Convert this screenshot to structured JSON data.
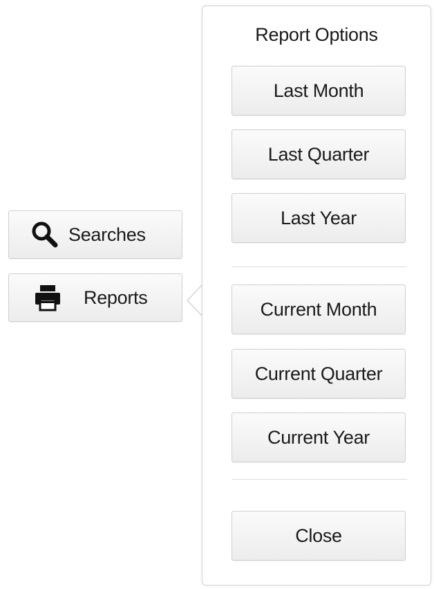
{
  "sidebar": {
    "buttons": [
      {
        "label": "Searches",
        "icon": "search-icon"
      },
      {
        "label": "Reports",
        "icon": "printer-icon"
      }
    ]
  },
  "report_options": {
    "title": "Report Options",
    "past_options": [
      "Last Month",
      "Last Quarter",
      "Last Year"
    ],
    "current_options": [
      "Current Month",
      "Current Quarter",
      "Current Year"
    ],
    "close_label": "Close"
  },
  "colors": {
    "button_border": "#cfcfcf",
    "popover_border": "#d4d4d4",
    "icon": "#111111"
  }
}
